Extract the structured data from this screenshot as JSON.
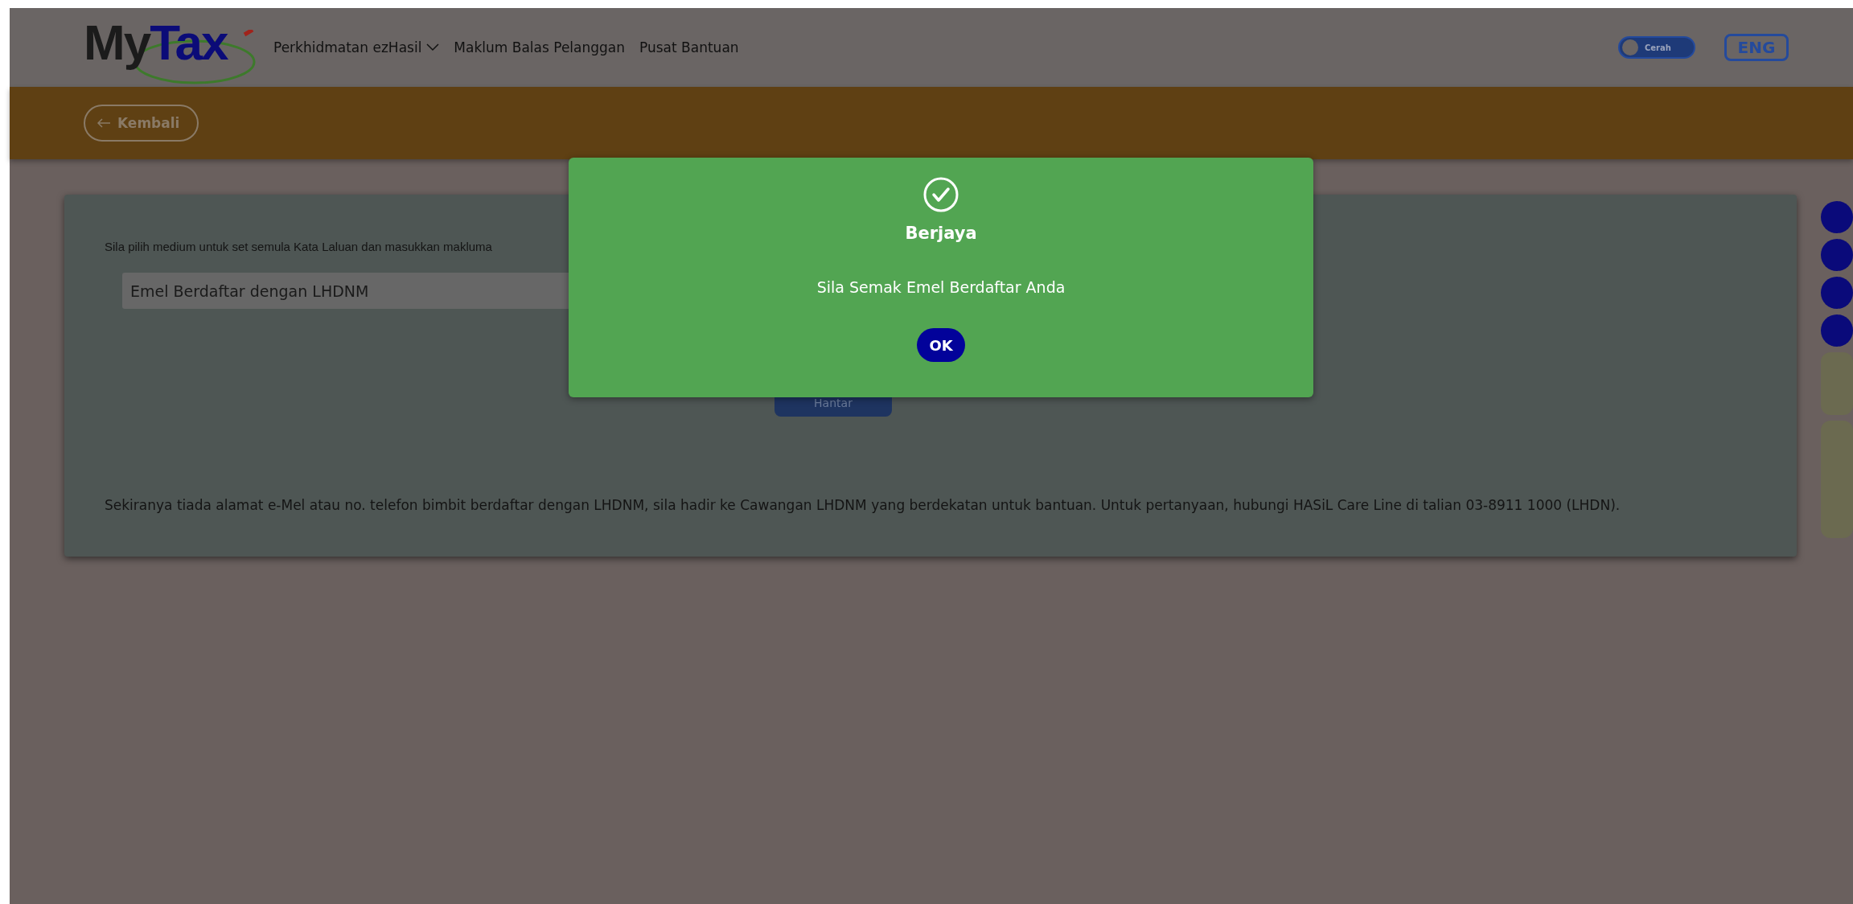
{
  "header": {
    "logo": {
      "part_1": "My",
      "part_2": "Tax"
    },
    "nav": [
      {
        "label": "Perkhidmatan ezHasil",
        "dropdown": true
      },
      {
        "label": "Maklum Balas Pelanggan",
        "dropdown": false
      },
      {
        "label": "Pusat Bantuan",
        "dropdown": false
      }
    ],
    "theme_toggle": {
      "label": "Cerah",
      "on": false
    },
    "language_button": "ENG"
  },
  "back_button": "Kembali",
  "form": {
    "instruction": "Sila pilih medium untuk set semula Kata Laluan dan masukkan makluma",
    "medium_select": {
      "value": "Emel Berdaftar dengan LHDNM"
    },
    "submit_button": "Hantar",
    "note": "Sekiranya tiada alamat e-Mel atau no. telefon bimbit berdaftar dengan LHDNM, sila hadir ke Cawangan LHDNM yang berdekatan untuk bantuan. Untuk pertanyaan, hubungi HASiL Care Line di talian 03-8911 1000 (LHDN)."
  },
  "dialog": {
    "title": "Berjaya",
    "message": "Sila Semak Emel Berdaftar Anda",
    "button": "OK"
  }
}
